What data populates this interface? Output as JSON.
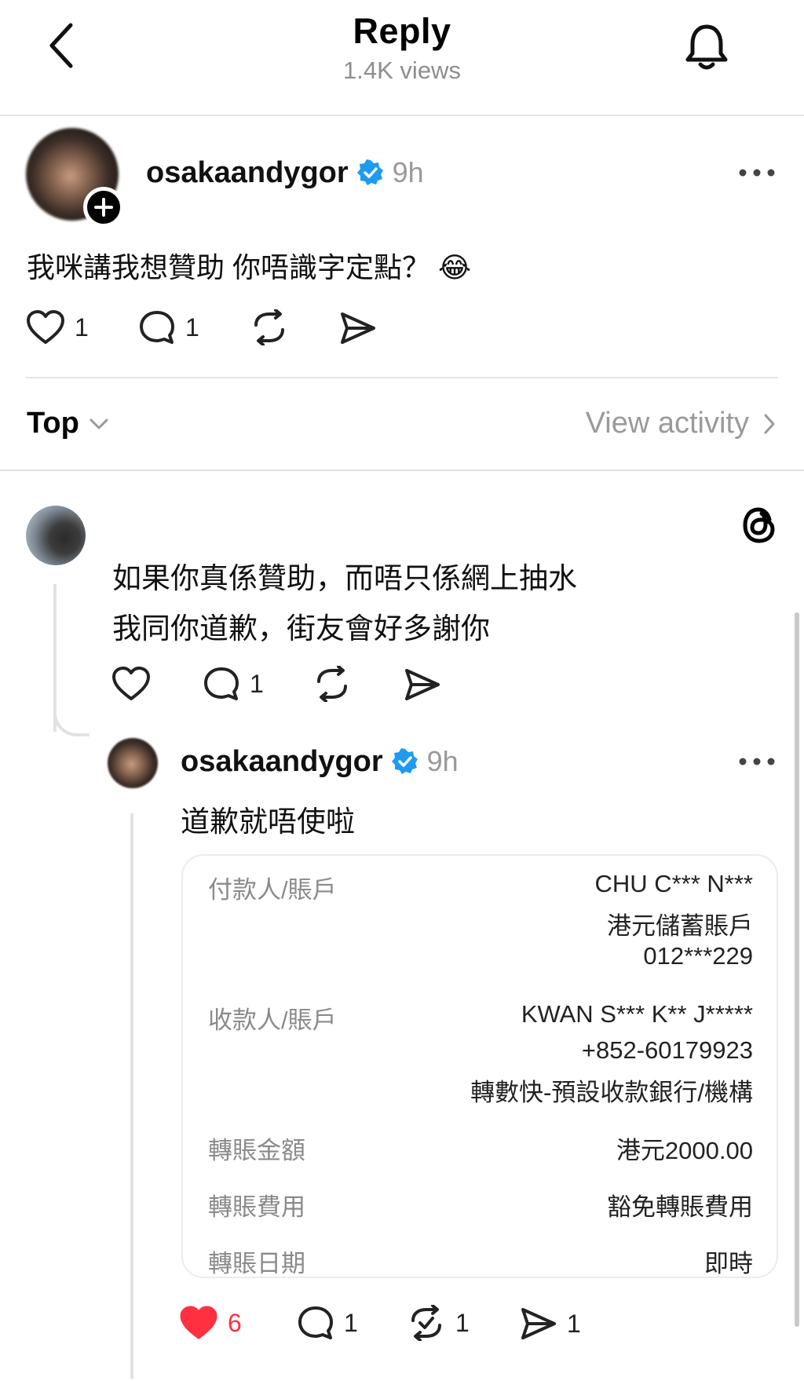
{
  "header": {
    "title": "Reply",
    "views": "1.4K views"
  },
  "post": {
    "username": "osakaandygor",
    "time": "9h",
    "text": "我咪講我想贊助 你唔識字定點？ 😂",
    "likes": "1",
    "replies": "1"
  },
  "sort": {
    "label": "Top",
    "view_activity": "View activity"
  },
  "comment": {
    "line1": "如果你真係贊助，而唔只係網上抽水",
    "line2": "我同你道歉，街友會好多謝你",
    "replies": "1"
  },
  "reply": {
    "username": "osakaandygor",
    "time": "9h",
    "text": "道歉就唔使啦",
    "likes": "6",
    "replies": "1",
    "reposts": "1",
    "shares": "1"
  },
  "receipt": {
    "payer_label": "付款人/賬戶",
    "payer_name": "CHU C*** N***",
    "payer_account_type": "港元儲蓄賬戶",
    "payer_account": "012***229",
    "payee_label": "收款人/賬戶",
    "payee_name": "KWAN S*** K** J*****",
    "payee_phone": "+852-60179923",
    "payee_bank": "轉數快-預設收款銀行/機構",
    "amount_label": "轉賬金額",
    "amount": "港元2000.00",
    "fee_label": "轉賬費用",
    "fee": "豁免轉賬費用",
    "date_label": "轉賬日期",
    "date": "即時"
  },
  "colors": {
    "verified": "#1d9bf0",
    "like_active": "#ff3040",
    "muted": "#8e8e8e"
  },
  "icons": [
    "back-arrow-icon",
    "bell-icon",
    "plus-icon",
    "verified-badge-icon",
    "more-icon",
    "heart-icon",
    "comment-icon",
    "repost-icon",
    "share-icon",
    "chevron-down-icon",
    "chevron-right-icon",
    "threads-logo-icon"
  ]
}
